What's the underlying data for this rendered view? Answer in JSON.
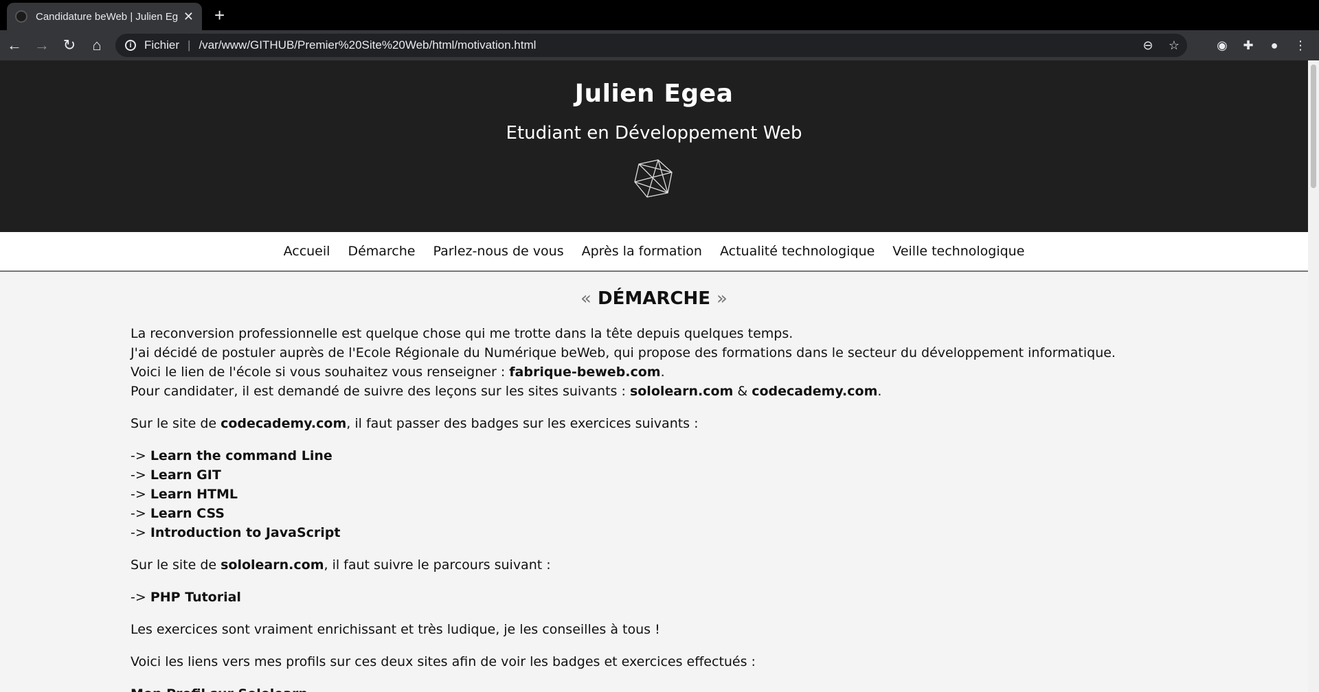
{
  "browser": {
    "tab_title": "Candidature beWeb | Julien Egea",
    "new_tab": "+",
    "scheme_label": "Fichier",
    "url": "/var/www/GITHUB/Premier%20Site%20Web/html/motivation.html"
  },
  "header": {
    "name": "Julien Egea",
    "subtitle": "Etudiant en Développement Web"
  },
  "nav": [
    "Accueil",
    "Démarche",
    "Parlez-nous de vous",
    "Après la formation",
    "Actualité technologique",
    "Veille technologique"
  ],
  "content": {
    "title_open": "«",
    "title": "DÉMARCHE",
    "title_close": "»",
    "intro_1": "La reconversion professionnelle est quelque chose qui me trotte dans la tête depuis quelques temps.",
    "intro_2": "J'ai décidé de postuler auprès de l'Ecole Régionale du Numérique beWeb, qui propose des formations dans le secteur du développement informatique.",
    "intro_3_pre": "Voici le lien de l'école si vous souhaitez vous renseigner : ",
    "intro_3_link": "fabrique-beweb.com",
    "intro_3_post": ".",
    "intro_4_pre": "Pour candidater, il est demandé de suivre des leçons sur les sites suivants : ",
    "intro_4_link1": "sololearn.com",
    "intro_4_mid": " & ",
    "intro_4_link2": "codecademy.com",
    "intro_4_post": ".",
    "codecademy_pre": "Sur le site de ",
    "codecademy_link": "codecademy.com",
    "codecademy_post": ", il faut passer des badges sur les exercices suivants :",
    "arrow": "-> ",
    "codecademy_items": [
      "Learn the command Line",
      "Learn GIT",
      "Learn HTML",
      "Learn CSS",
      "Introduction to JavaScript"
    ],
    "sololearn_pre": "Sur le site de ",
    "sololearn_link": "sololearn.com",
    "sololearn_post": ", il faut suivre le parcours suivant :",
    "sololearn_item": "PHP Tutorial",
    "exercises_note": "Les exercices sont vraiment enrichissant et très ludique, je les conseilles à tous !",
    "profiles_note": "Voici les liens vers mes profils sur ces deux sites afin de voir les badges et exercices effectués :",
    "profile_cut": "Mon Profil sur Sololearn"
  }
}
